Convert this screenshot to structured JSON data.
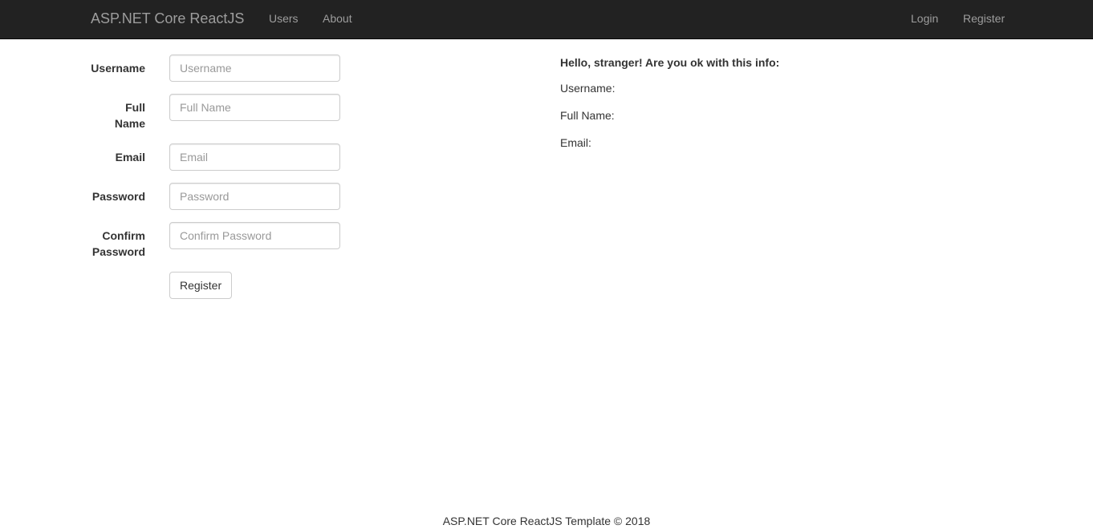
{
  "navbar": {
    "brand": "ASP.NET Core ReactJS",
    "left_links": [
      "Users",
      "About"
    ],
    "right_links": [
      "Login",
      "Register"
    ]
  },
  "form": {
    "username_label": "Username",
    "username_placeholder": "Username",
    "fullname_label_line1": "Full",
    "fullname_label_line2": "Name",
    "fullname_placeholder": "Full Name",
    "email_label": "Email",
    "email_placeholder": "Email",
    "password_label": "Password",
    "password_placeholder": "Password",
    "confirm_label_line1": "Confirm",
    "confirm_label_line2": "Password",
    "confirm_placeholder": "Confirm Password",
    "submit_label": "Register"
  },
  "info": {
    "heading": "Hello, stranger! Are you ok with this info:",
    "username_line": "Username:",
    "fullname_line": "Full Name:",
    "email_line": "Email:"
  },
  "footer": {
    "text": "ASP.NET Core ReactJS Template © 2018"
  }
}
